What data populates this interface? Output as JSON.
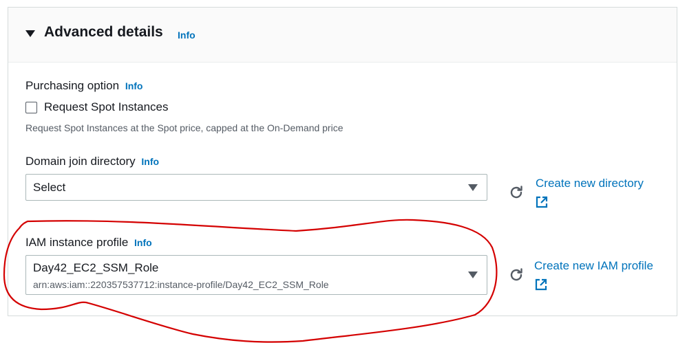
{
  "section": {
    "title": "Advanced details",
    "info": "Info"
  },
  "purchasing": {
    "label": "Purchasing option",
    "info": "Info",
    "checkbox_label": "Request Spot Instances",
    "hint": "Request Spot Instances at the Spot price, capped at the On-Demand price",
    "checked": false
  },
  "domain_join": {
    "label": "Domain join directory",
    "info": "Info",
    "selected": "Select",
    "create_link": "Create new directory"
  },
  "iam_profile": {
    "label": "IAM instance profile",
    "info": "Info",
    "selected": "Day42_EC2_SSM_Role",
    "selected_arn": "arn:aws:iam::220357537712:instance-profile/Day42_EC2_SSM_Role",
    "create_link": "Create new IAM profile"
  },
  "colors": {
    "link": "#0073bb",
    "annotation": "#d40000"
  },
  "icons": [
    "caret-down-icon",
    "refresh-icon",
    "external-link-icon",
    "dropdown-arrow-icon"
  ]
}
